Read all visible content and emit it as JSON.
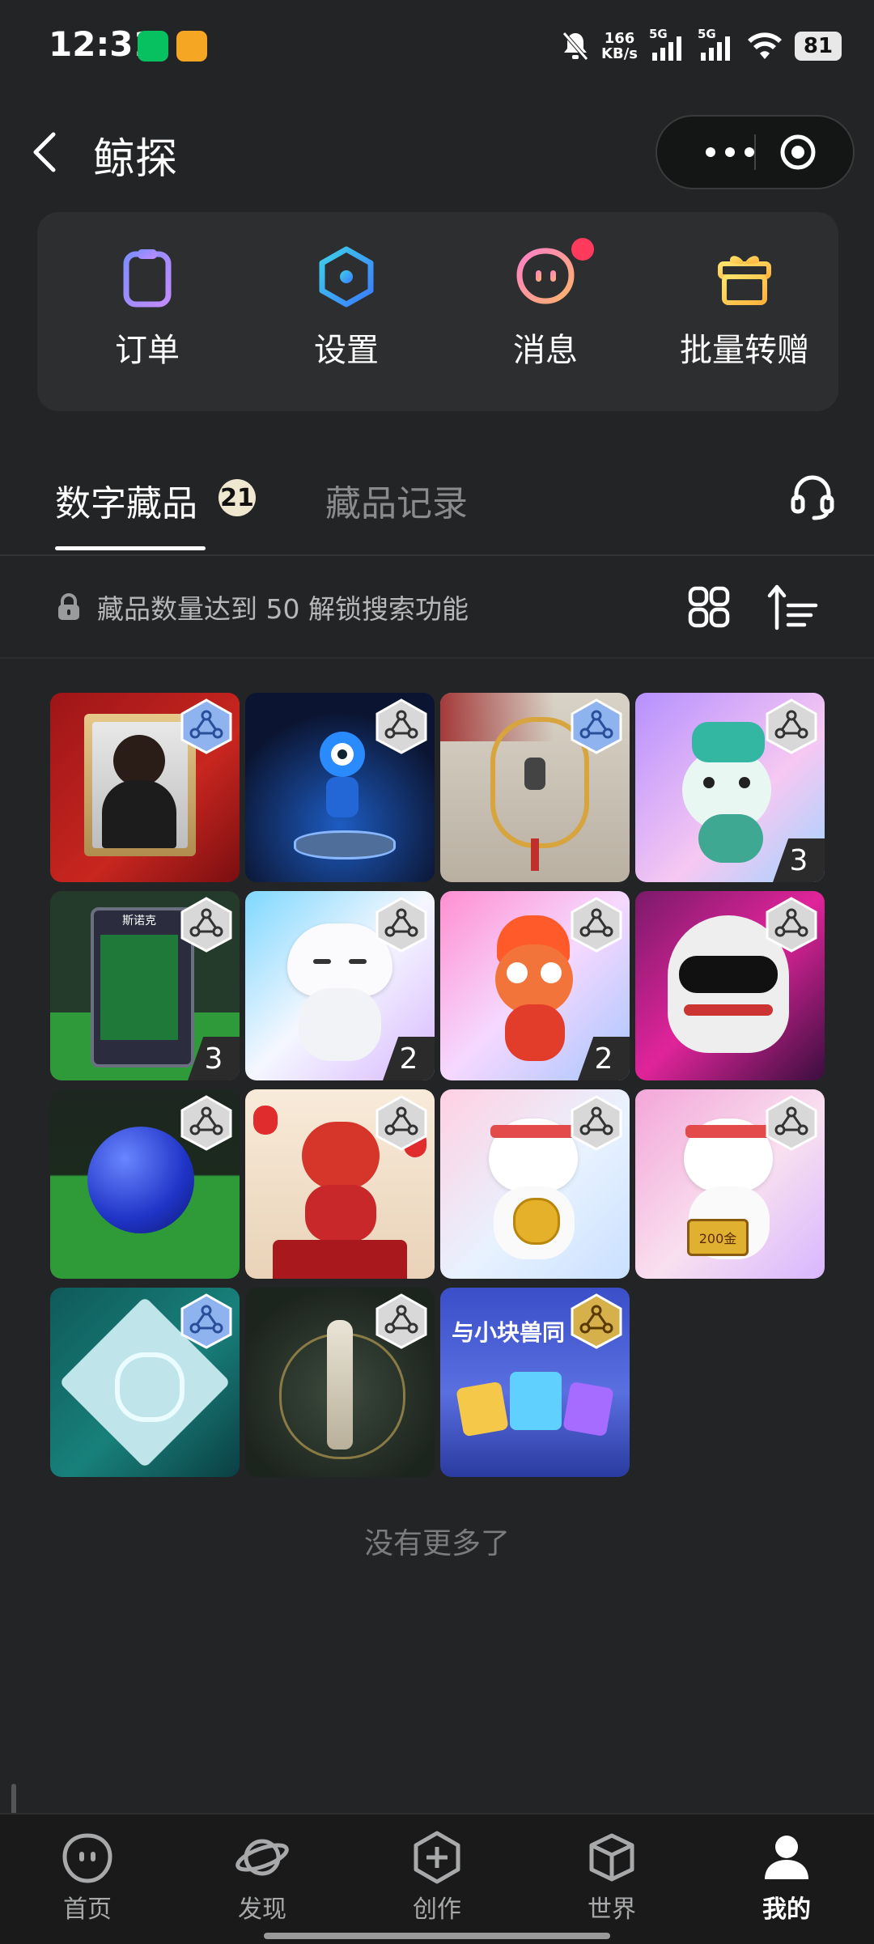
{
  "status_bar": {
    "time": "12:31",
    "speed": "166",
    "speed_unit": "KB/s",
    "sig1": "5G",
    "sig2": "5G",
    "battery": "81"
  },
  "header": {
    "title": "鲸探"
  },
  "quick_actions": [
    {
      "label": "订单",
      "icon": "clipboard-icon"
    },
    {
      "label": "设置",
      "icon": "hexagon-settings-icon"
    },
    {
      "label": "消息",
      "icon": "message-face-icon"
    },
    {
      "label": "批量转赠",
      "icon": "gift-icon"
    }
  ],
  "tabs": {
    "active_label": "数字藏品",
    "active_count": "21",
    "inactive_label": "藏品记录"
  },
  "filter": {
    "text": "藏品数量达到 50 解锁搜索功能"
  },
  "collection": [
    {
      "name": "portrait-card",
      "badge": "blue",
      "count": ""
    },
    {
      "name": "blue-robot",
      "badge": "gray",
      "count": ""
    },
    {
      "name": "lantern-scene",
      "badge": "blue",
      "count": ""
    },
    {
      "name": "jade-dragon",
      "badge": "gray",
      "count": "3"
    },
    {
      "name": "snooker-card",
      "badge": "gray",
      "count": "3"
    },
    {
      "name": "white-tiger",
      "badge": "gray",
      "count": "2"
    },
    {
      "name": "red-phoenix",
      "badge": "gray",
      "count": "2"
    },
    {
      "name": "racing-helmet",
      "badge": "gray",
      "count": ""
    },
    {
      "name": "snooker-ball",
      "badge": "gray",
      "count": ""
    },
    {
      "name": "red-dragon",
      "badge": "gray",
      "count": ""
    },
    {
      "name": "lucky-cat-coin",
      "badge": "gray",
      "count": ""
    },
    {
      "name": "lucky-cat-gold",
      "badge": "gray",
      "count": ""
    },
    {
      "name": "fu-paper-cut",
      "badge": "blue",
      "count": ""
    },
    {
      "name": "bottle-coin",
      "badge": "gray",
      "count": ""
    },
    {
      "name": "block-characters",
      "badge": "gold",
      "count": ""
    }
  ],
  "card_texts": {
    "snooker": "斯诺克",
    "block_banner": "与小块兽同",
    "coin_label": "200金"
  },
  "no_more": "没有更多了",
  "bottom_nav": [
    {
      "label": "首页",
      "icon": "home-face-icon",
      "active": false
    },
    {
      "label": "发现",
      "icon": "planet-icon",
      "active": false
    },
    {
      "label": "创作",
      "icon": "create-plus-icon",
      "active": false
    },
    {
      "label": "世界",
      "icon": "cube-icon",
      "active": false
    },
    {
      "label": "我的",
      "icon": "user-icon",
      "active": true
    }
  ],
  "colors": {
    "background": "#232425",
    "accent_dot": "#ff3a5c",
    "badge_blue": "#7aa9f0",
    "badge_gold": "#d6b04a"
  }
}
